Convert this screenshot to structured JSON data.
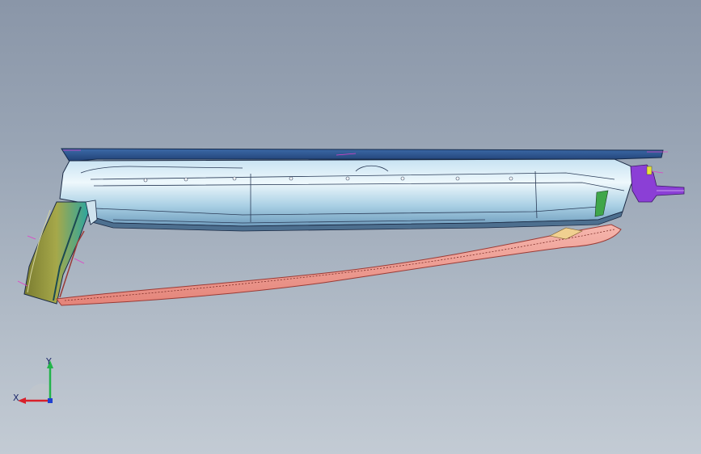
{
  "viewport": {
    "background_top": "#8a96a8",
    "background_bottom": "#c3cbd4"
  },
  "model": {
    "colors": {
      "top_panel": "#2a4f8a",
      "body_light": "#d8ecf6",
      "body_mid": "#a9cde3",
      "body_dark": "#6f9cbd",
      "edge": "#1b2a44",
      "seal_fill": "#f3a29a",
      "seal_edge": "#9a3b36",
      "pillar_teal": "#2aa6a0",
      "pillar_olive": "#8d8f3a",
      "bracket_purple": "#8b3fd6",
      "dimension_magenta": "#e040c8",
      "green_accent": "#3fa64a",
      "yellow_accent": "#e8e23a"
    }
  },
  "triad": {
    "x_label": "X",
    "y_label": "Y",
    "x_color": "#d8202a",
    "y_color": "#22b34a",
    "z_color": "#2040d0"
  }
}
